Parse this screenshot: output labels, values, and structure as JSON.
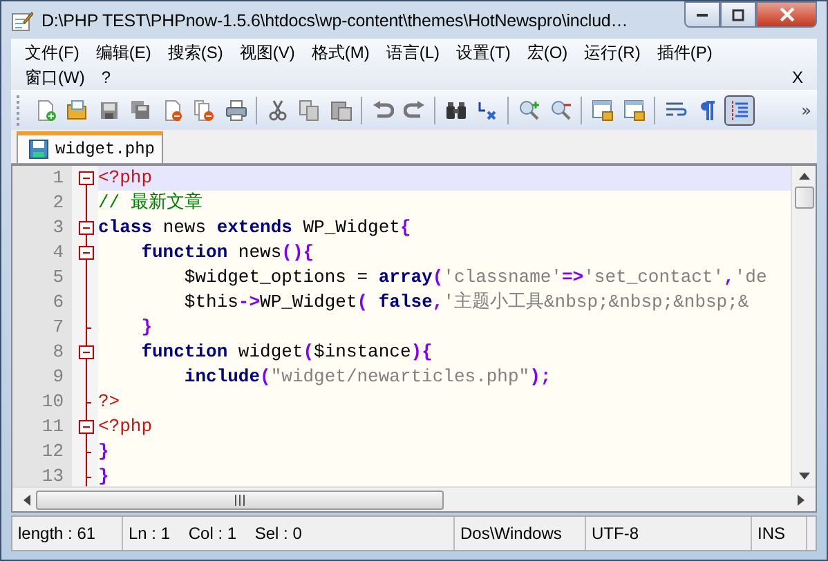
{
  "window": {
    "title": "D:\\PHP TEST\\PHPnow-1.5.6\\htdocs\\wp-content\\themes\\HotNewspro\\includ…"
  },
  "menu": [
    {
      "label": "文件(F)"
    },
    {
      "label": "编辑(E)"
    },
    {
      "label": "搜索(S)"
    },
    {
      "label": "视图(V)"
    },
    {
      "label": "格式(M)"
    },
    {
      "label": "语言(L)"
    },
    {
      "label": "设置(T)"
    },
    {
      "label": "宏(O)"
    },
    {
      "label": "运行(R)"
    },
    {
      "label": "插件(P)"
    },
    {
      "label": "窗口(W)"
    },
    {
      "label": "?"
    }
  ],
  "menu_close": "X",
  "toolbar": [
    {
      "kind": "new",
      "pressed": false
    },
    {
      "kind": "open",
      "pressed": false
    },
    {
      "kind": "save",
      "pressed": false
    },
    {
      "kind": "saveall",
      "pressed": false
    },
    {
      "kind": "close",
      "pressed": false
    },
    {
      "kind": "closeall",
      "pressed": false
    },
    {
      "kind": "print",
      "pressed": false
    },
    {
      "kind": "separator"
    },
    {
      "kind": "cut",
      "pressed": false
    },
    {
      "kind": "copy",
      "pressed": false
    },
    {
      "kind": "paste",
      "pressed": false
    },
    {
      "kind": "separator"
    },
    {
      "kind": "undo",
      "pressed": false
    },
    {
      "kind": "redo",
      "pressed": false
    },
    {
      "kind": "separator"
    },
    {
      "kind": "find",
      "pressed": false
    },
    {
      "kind": "replace",
      "pressed": false
    },
    {
      "kind": "separator"
    },
    {
      "kind": "zoomin",
      "pressed": false
    },
    {
      "kind": "zoomout",
      "pressed": false
    },
    {
      "kind": "separator"
    },
    {
      "kind": "syncv",
      "pressed": false
    },
    {
      "kind": "synch",
      "pressed": false
    },
    {
      "kind": "separator"
    },
    {
      "kind": "wrap",
      "pressed": false
    },
    {
      "kind": "pilcrow",
      "pressed": false
    },
    {
      "kind": "guide",
      "pressed": true
    }
  ],
  "toolbar_more": "»",
  "tabs": [
    {
      "label": "widget.php",
      "selected": true
    }
  ],
  "editor": {
    "lines": [
      {
        "number": "1",
        "kind": "start",
        "current": true,
        "tokens": [
          {
            "kind": "tag",
            "text": "<?php"
          }
        ]
      },
      {
        "number": "2",
        "kind": "body",
        "current": false,
        "tokens": [
          {
            "kind": "comment",
            "text": "// 最新文章"
          }
        ]
      },
      {
        "number": "3",
        "kind": "start",
        "current": false,
        "tokens": [
          {
            "kind": "keyword",
            "text": "class"
          },
          {
            "kind": "plain",
            "text": " news "
          },
          {
            "kind": "keyword",
            "text": "extends"
          },
          {
            "kind": "plain",
            "text": " WP_Widget"
          },
          {
            "kind": "op",
            "text": "{"
          }
        ]
      },
      {
        "number": "4",
        "kind": "start",
        "current": false,
        "tokens": [
          {
            "kind": "keyword",
            "text": "    function"
          },
          {
            "kind": "plain",
            "text": " news"
          },
          {
            "kind": "op",
            "text": "(){"
          }
        ]
      },
      {
        "number": "5",
        "kind": "body",
        "current": false,
        "tokens": [
          {
            "kind": "plain",
            "text": "        $widget_options = "
          },
          {
            "kind": "keyword",
            "text": "array"
          },
          {
            "kind": "op",
            "text": "("
          },
          {
            "kind": "string",
            "text": "'classname'"
          },
          {
            "kind": "op",
            "text": "=>"
          },
          {
            "kind": "string",
            "text": "'set_contact'"
          },
          {
            "kind": "op",
            "text": ","
          },
          {
            "kind": "string",
            "text": "'de"
          }
        ]
      },
      {
        "number": "6",
        "kind": "body",
        "current": false,
        "tokens": [
          {
            "kind": "plain",
            "text": "        $this"
          },
          {
            "kind": "op",
            "text": "->"
          },
          {
            "kind": "plain",
            "text": "WP_Widget"
          },
          {
            "kind": "op",
            "text": "( "
          },
          {
            "kind": "keyword",
            "text": "false"
          },
          {
            "kind": "op",
            "text": ","
          },
          {
            "kind": "string",
            "text": "'主题小工具&nbsp;&nbsp;&nbsp;&"
          }
        ]
      },
      {
        "number": "7",
        "kind": "end",
        "current": false,
        "tokens": [
          {
            "kind": "op",
            "text": "    }"
          }
        ]
      },
      {
        "number": "8",
        "kind": "start",
        "current": false,
        "tokens": [
          {
            "kind": "keyword",
            "text": "    function"
          },
          {
            "kind": "plain",
            "text": " widget"
          },
          {
            "kind": "op",
            "text": "("
          },
          {
            "kind": "plain",
            "text": "$instance"
          },
          {
            "kind": "op",
            "text": "){"
          }
        ]
      },
      {
        "number": "9",
        "kind": "body",
        "current": false,
        "tokens": [
          {
            "kind": "keyword",
            "text": "        include"
          },
          {
            "kind": "op",
            "text": "("
          },
          {
            "kind": "string",
            "text": "\"widget/newarticles.php\""
          },
          {
            "kind": "op",
            "text": ");"
          }
        ]
      },
      {
        "number": "10",
        "kind": "end",
        "current": false,
        "tokens": [
          {
            "kind": "tag",
            "text": "?>"
          }
        ]
      },
      {
        "number": "11",
        "kind": "start",
        "current": false,
        "tokens": [
          {
            "kind": "tag",
            "text": "<?php"
          }
        ]
      },
      {
        "number": "12",
        "kind": "end",
        "current": false,
        "tokens": [
          {
            "kind": "op",
            "text": "}"
          }
        ]
      },
      {
        "number": "13",
        "kind": "end",
        "current": false,
        "tokens": [
          {
            "kind": "op",
            "text": "}"
          }
        ]
      }
    ]
  },
  "status_bar": [
    {
      "text": "length : 61"
    },
    {
      "text": "Ln : 1    Col : 1    Sel : 0"
    },
    {
      "text": "Dos\\Windows"
    },
    {
      "text": "UTF-8"
    },
    {
      "text": "INS"
    }
  ]
}
